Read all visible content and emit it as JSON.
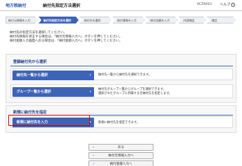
{
  "header": {
    "tax": "地方税納付",
    "title": "納付先指定方法選択",
    "screen_id": "BCZN003",
    "help": "ヘルプ",
    "help_icon": "?"
  },
  "steps": [
    {
      "label": "納付元情報を入力",
      "active": false
    },
    {
      "label": "納付先指定方法を選択",
      "active": true
    },
    {
      "label": "納付先を選択",
      "active": false
    },
    {
      "label": "納付情報を入力",
      "active": false
    },
    {
      "label": "納付金額を入力",
      "active": false
    },
    {
      "label": "内容確認",
      "active": false
    },
    {
      "label": "確定",
      "active": false
    }
  ],
  "intro": {
    "line1": "納付先の指定方法を選択してください。",
    "line2": "納付先情報を修正する場合は、「納付元情報入力へ」ボタンを押してください。",
    "line3": "納付金額入力画面へ戻る場合は、「納付金額入力へ」ボタンを押してください。"
  },
  "registered": {
    "title": "登録納付先から選択",
    "rows": [
      {
        "button": "納付先一覧から選択",
        "desc1": "納付先一覧から納付先を選択できます。",
        "desc2": ""
      },
      {
        "button": "グループ一覧から選択",
        "desc1": "納付先グループ一覧からグループを選択できます。",
        "desc2": "選択されたグループに所属する全納付先を指定します。"
      }
    ]
  },
  "new_entry": {
    "title": "新規に納付先を指定",
    "button": "新規に納付先を入力",
    "desc": "新規に納付先を指定できます。"
  },
  "chevron": "›",
  "back_chevron": "‹",
  "bottom": {
    "back": "戻る",
    "to_payer": "納付元情報入力へ",
    "to_amount": "納付金額入力へ"
  }
}
